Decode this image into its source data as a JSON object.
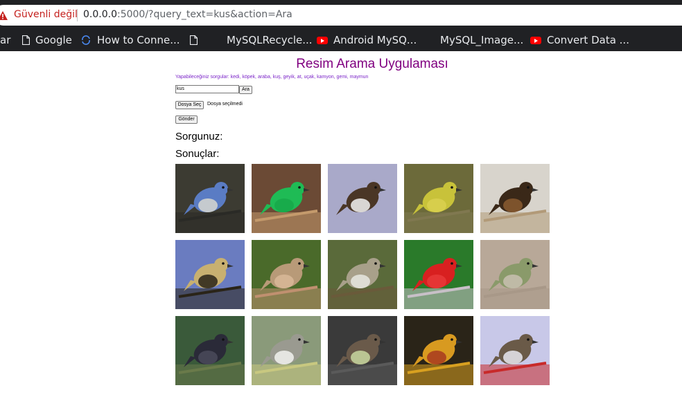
{
  "browser": {
    "security_label": "Güvenli değil",
    "url_host": "0.0.0.0",
    "url_rest": ":5000/?query_text=kus&action=Ara"
  },
  "bookmarks": [
    {
      "label": "ar",
      "icon": "none"
    },
    {
      "label": "Google",
      "icon": "file-icon"
    },
    {
      "label": "How to Conne...",
      "icon": "link-icon"
    },
    {
      "label": "MySQLRecycle...",
      "icon": "file-icon"
    },
    {
      "label": "Android MySQ...",
      "icon": "youtube-icon"
    },
    {
      "label": "MySQL_Image...",
      "icon": "none"
    },
    {
      "label": "Convert Data ...",
      "icon": "youtube-icon"
    }
  ],
  "app": {
    "title": "Resim Arama Uygulaması",
    "hint": "Yapabileceğiniz sorgular: kedi, köpek, araba, kuş, geyik, at, uçak, kamyon, gemi, maymun",
    "query_value": "kus",
    "search_button": "Ara",
    "file_button": "Dosya Seç",
    "file_status": "Dosya seçilmedi",
    "submit_button": "Gönder",
    "query_heading": "Sorgunuz:",
    "results_heading": "Sonuçlar:"
  },
  "colors": {
    "title": "#800080",
    "hint": "#7b24c8",
    "warning": "#c5221f"
  },
  "results": [
    {
      "bg": "#3c3b32",
      "body": "#5a7cc4",
      "belly": "#d8d8d0",
      "branch": "#2a2a26"
    },
    {
      "bg": "#6b4a35",
      "body": "#1fbb55",
      "belly": "#17a84a",
      "branch": "#c49a6c"
    },
    {
      "bg": "#a9a9c9",
      "body": "#4a3626",
      "belly": "#f2f2f2",
      "branch": "#a9a9c9"
    },
    {
      "bg": "#6c6a3a",
      "body": "#c8c23a",
      "belly": "#d9d050",
      "branch": "#807850"
    },
    {
      "bg": "#d8d4cc",
      "body": "#3a2818",
      "belly": "#8a5a30",
      "branch": "#b29a78"
    },
    {
      "bg": "#6a7cc0",
      "body": "#c8b070",
      "belly": "#2a2418",
      "branch": "#2a2418"
    },
    {
      "bg": "#4a6a2a",
      "body": "#b89a78",
      "belly": "#d8b898",
      "branch": "#c09070"
    },
    {
      "bg": "#5a6a3a",
      "body": "#a8a08a",
      "belly": "#e8e8e0",
      "branch": "#6a5a3a"
    },
    {
      "bg": "#2a7a2a",
      "body": "#d82020",
      "belly": "#e83a3a",
      "branch": "#c8c0c8"
    },
    {
      "bg": "#b8a898",
      "body": "#8a9a6a",
      "belly": "#c8c0b0",
      "branch": "#a89888"
    },
    {
      "bg": "#3a5a3a",
      "body": "#2a2a38",
      "belly": "#4a4a5a",
      "branch": "#6a7a4a"
    },
    {
      "bg": "#8a9a7a",
      "body": "#9a9a90",
      "belly": "#f2f2f0",
      "branch": "#c8c880"
    },
    {
      "bg": "#3a3a3a",
      "body": "#6a5a4a",
      "belly": "#c8d8a0",
      "branch": "#5a5a5a"
    },
    {
      "bg": "#2a2418",
      "body": "#d89a20",
      "belly": "#a83a20",
      "branch": "#d8a020"
    },
    {
      "bg": "#c8c8e8",
      "body": "#6a5a48",
      "belly": "#e8e8f0",
      "branch": "#c82a2a"
    }
  ]
}
